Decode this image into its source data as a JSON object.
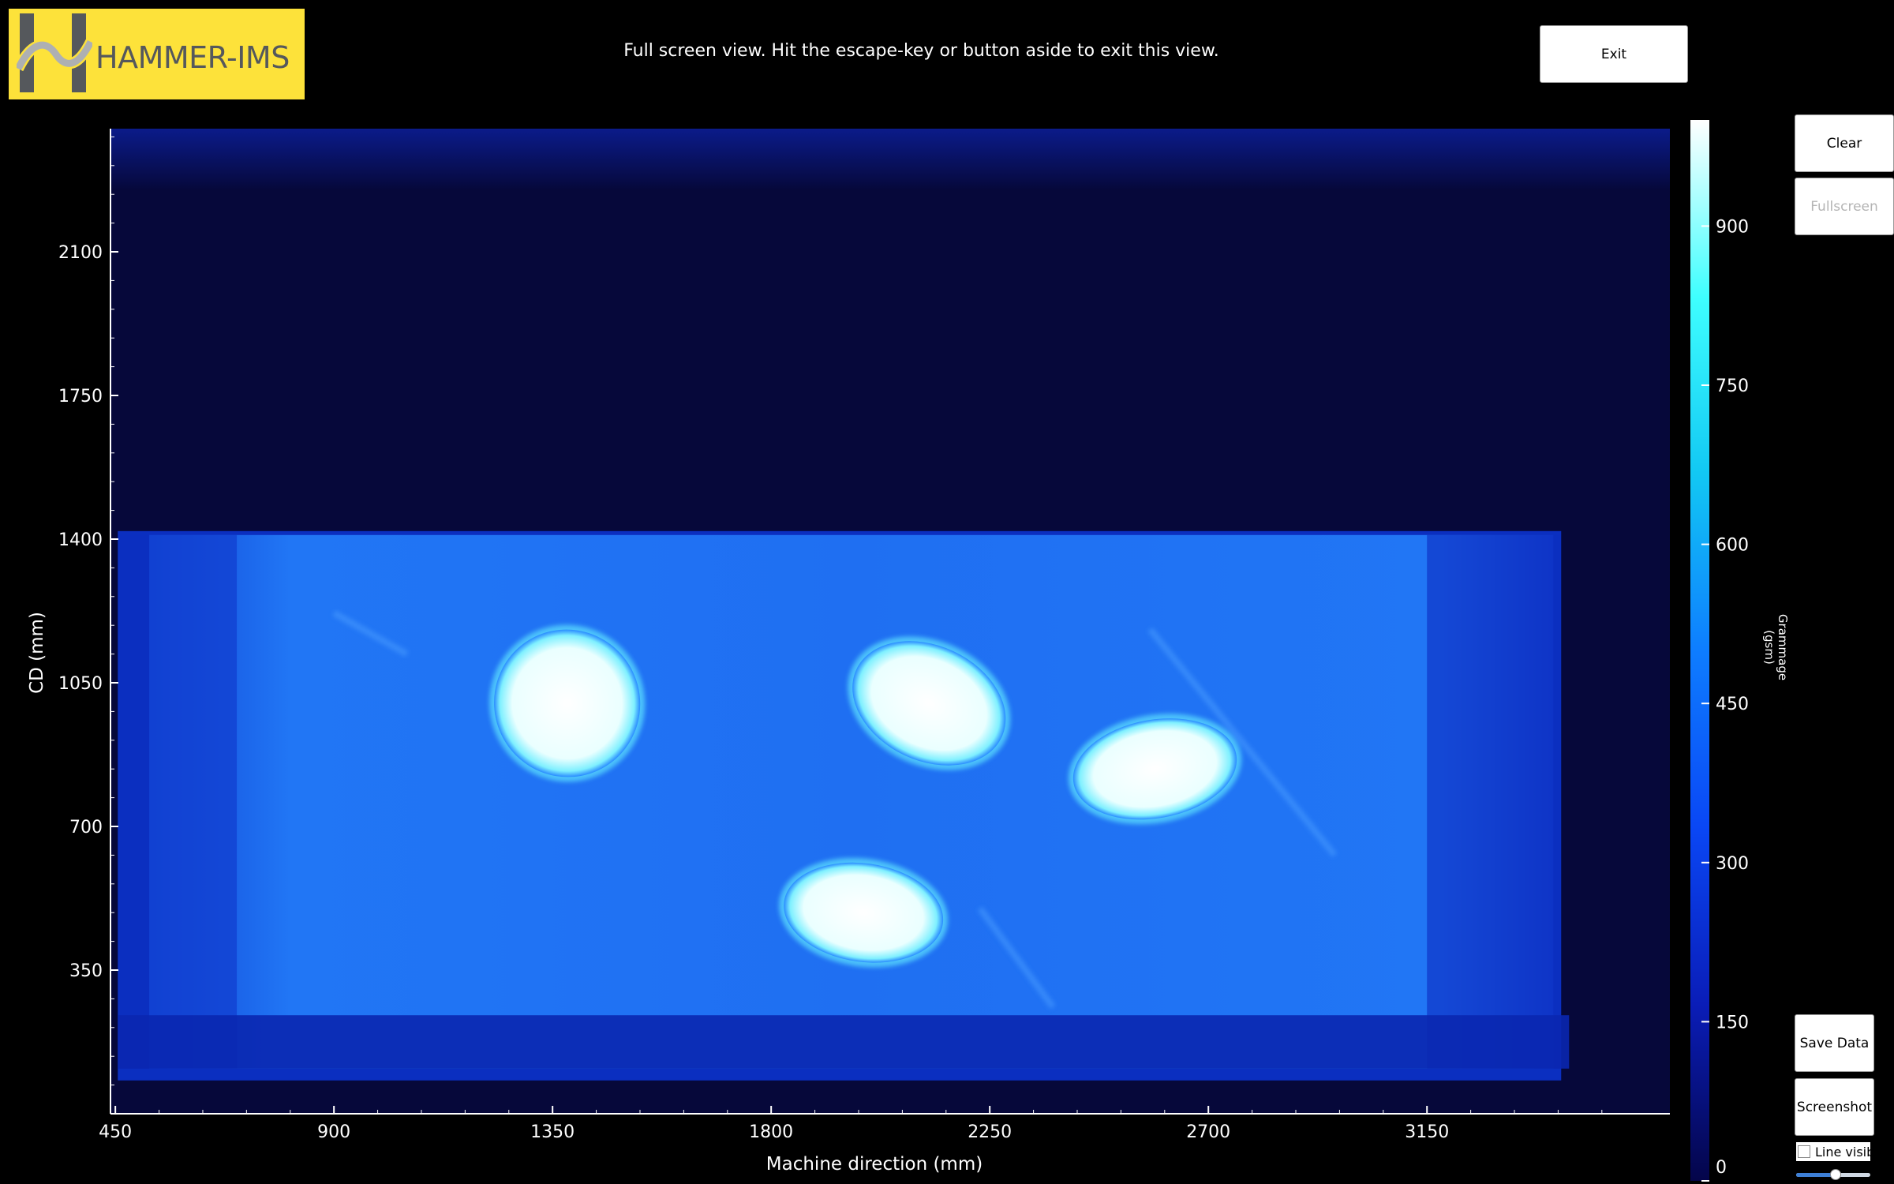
{
  "logo": {
    "wordmark": "HAMMER-IMS",
    "brand_color": "#fde23a",
    "mark_color": "#55585c"
  },
  "banner": {
    "text": "Full screen view. Hit the escape-key or button aside to exit this view."
  },
  "buttons": {
    "exit": "Exit",
    "clear": "Clear",
    "fullscreen": "Fullscreen",
    "save_data": "Save Data",
    "screenshot": "Screenshot"
  },
  "line_visibility": {
    "label": "Line visibi",
    "checked": false,
    "slider_value": 0.53
  },
  "colors": {
    "background": "#000000",
    "scan_empty": "#06083a",
    "scan_sheet": "#1d68f0",
    "scan_samples": "#f2ffff"
  },
  "chart_data": {
    "type": "heatmap",
    "title": "",
    "xlabel": "Machine direction (mm)",
    "ylabel": "CD (mm)",
    "xlim": [
      440,
      3650
    ],
    "ylim": [
      0,
      2400
    ],
    "x_ticks": [
      450,
      900,
      1350,
      1800,
      2250,
      2700,
      3150
    ],
    "y_ticks": [
      350,
      700,
      1050,
      1400,
      1750,
      2100
    ],
    "colorbar": {
      "label": "Grammage (gsm)",
      "range": [
        0,
        1000
      ],
      "ticks": [
        0,
        150,
        300,
        450,
        600,
        750,
        900
      ],
      "colormap": [
        "#04054a",
        "#0a1db8",
        "#0a47f5",
        "#0e7dff",
        "#12c8f3",
        "#3fffff",
        "#ffffff"
      ]
    },
    "regions": [
      {
        "name": "sheet",
        "x": [
          520,
          3410
        ],
        "y": [
          110,
          1410
        ],
        "level": 450
      },
      {
        "name": "sample",
        "cx": 1380,
        "cy": 1000,
        "rx": 150,
        "ry": 180,
        "angle": 25,
        "level": 900
      },
      {
        "name": "sample",
        "cx": 2125,
        "cy": 1000,
        "rx": 165,
        "ry": 140,
        "angle": -25,
        "level": 900
      },
      {
        "name": "sample",
        "cx": 2590,
        "cy": 840,
        "rx": 170,
        "ry": 120,
        "angle": 10,
        "level": 900
      },
      {
        "name": "sample",
        "cx": 1990,
        "cy": 490,
        "rx": 165,
        "ry": 120,
        "angle": -8,
        "level": 900
      }
    ]
  }
}
